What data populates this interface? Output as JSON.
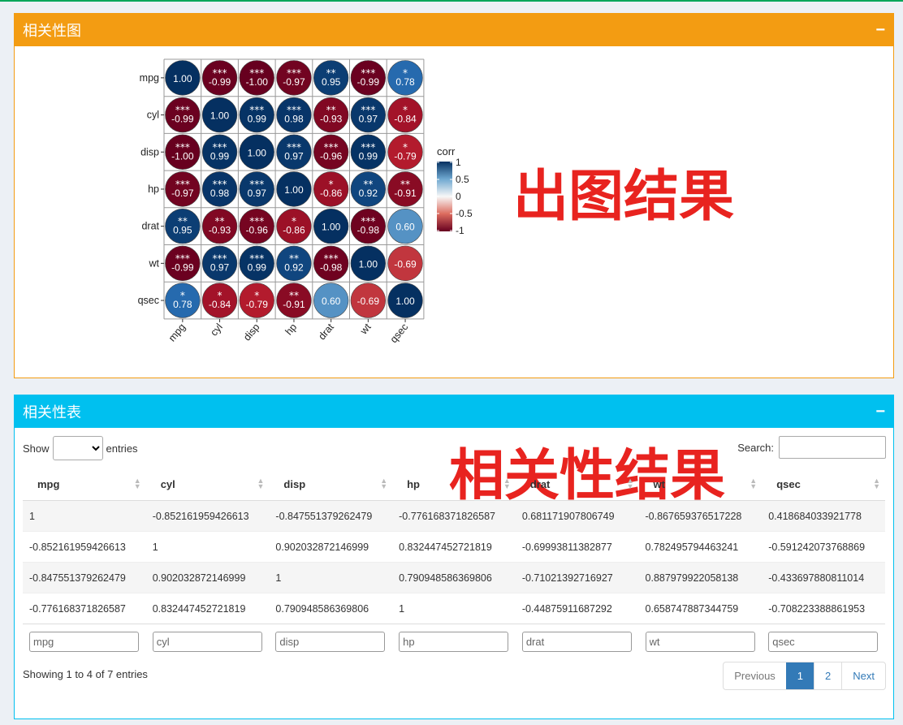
{
  "box1": {
    "title": "相关性图",
    "collapse": "−"
  },
  "box2": {
    "title": "相关性表",
    "collapse": "−"
  },
  "overlay1": "出图结果",
  "overlay2": "相关性结果",
  "chart_data": {
    "type": "heatmap",
    "variables": [
      "mpg",
      "cyl",
      "disp",
      "hp",
      "drat",
      "wt",
      "qsec"
    ],
    "values": [
      [
        1.0,
        -0.99,
        -1.0,
        -0.97,
        0.95,
        -0.99,
        0.78
      ],
      [
        -0.99,
        1.0,
        0.99,
        0.98,
        -0.93,
        0.97,
        -0.84
      ],
      [
        -1.0,
        0.99,
        1.0,
        0.97,
        -0.96,
        0.99,
        -0.79
      ],
      [
        -0.97,
        0.98,
        0.97,
        1.0,
        -0.86,
        0.92,
        -0.91
      ],
      [
        0.95,
        -0.93,
        -0.96,
        -0.86,
        1.0,
        -0.98,
        0.6
      ],
      [
        -0.99,
        0.97,
        0.99,
        0.92,
        -0.98,
        1.0,
        -0.69
      ],
      [
        0.78,
        -0.84,
        -0.79,
        -0.91,
        0.6,
        -0.69,
        1.0
      ]
    ],
    "labels": [
      [
        "1.00",
        "-0.99",
        "-1.00",
        "-0.97",
        "0.95",
        "-0.99",
        "0.78"
      ],
      [
        "-0.99",
        "1.00",
        "0.99",
        "0.98",
        "-0.93",
        "0.97",
        "-0.84"
      ],
      [
        "-1.00",
        "0.99",
        "1.00",
        "0.97",
        "-0.96",
        "0.99",
        "-0.79"
      ],
      [
        "-0.97",
        "0.98",
        "0.97",
        "1.00",
        "-0.86",
        "0.92",
        "-0.91"
      ],
      [
        "0.95",
        "-0.93",
        "-0.96",
        "-0.86",
        "1.00",
        "-0.98",
        "0.60"
      ],
      [
        "-0.99",
        "0.97",
        "0.99",
        "0.92",
        "-0.98",
        "1.00",
        "-0.69"
      ],
      [
        "0.78",
        "-0.84",
        "-0.79",
        "-0.91",
        "0.60",
        "-0.69",
        "1.00"
      ]
    ],
    "stars": [
      [
        "",
        "***",
        "***",
        "***",
        "**",
        "***",
        "*"
      ],
      [
        "***",
        "",
        "***",
        "***",
        "**",
        "***",
        "*"
      ],
      [
        "***",
        "***",
        "",
        "***",
        "***",
        "***",
        "*"
      ],
      [
        "***",
        "***",
        "***",
        "",
        "*",
        "**",
        "**"
      ],
      [
        "**",
        "**",
        "***",
        "*",
        "",
        "***",
        ""
      ],
      [
        "***",
        "***",
        "***",
        "**",
        "***",
        "",
        ""
      ],
      [
        "*",
        "*",
        "*",
        "**",
        "",
        "",
        ""
      ]
    ],
    "legend": {
      "title": "corr",
      "ticks": [
        "1",
        "0.5",
        "0",
        "-0.5",
        "-1"
      ],
      "range": [
        -1,
        1
      ]
    },
    "colors": {
      "high": "#053061",
      "mid": "#f7f7f7",
      "low": "#67001f"
    }
  },
  "table": {
    "show_label": "Show",
    "entries_label": "entries",
    "search_label": "Search:",
    "columns": [
      "mpg",
      "cyl",
      "disp",
      "hp",
      "drat",
      "wt",
      "qsec"
    ],
    "rows": [
      [
        "1",
        "-0.852161959426613",
        "-0.847551379262479",
        "-0.776168371826587",
        "0.681171907806749",
        "-0.867659376517228",
        "0.418684033921778"
      ],
      [
        "-0.852161959426613",
        "1",
        "0.902032872146999",
        "0.832447452721819",
        "-0.69993811382877",
        "0.782495794463241",
        "-0.591242073768869"
      ],
      [
        "-0.847551379262479",
        "0.902032872146999",
        "1",
        "0.790948586369806",
        "-0.71021392716927",
        "0.887979922058138",
        "-0.433697880811014"
      ],
      [
        "-0.776168371826587",
        "0.832447452721819",
        "0.790948586369806",
        "1",
        "-0.44875911687292",
        "0.658747887344759",
        "-0.708223388861953"
      ]
    ],
    "filters": [
      "mpg",
      "cyl",
      "disp",
      "hp",
      "drat",
      "wt",
      "qsec"
    ],
    "info": "Showing 1 to 4 of 7 entries",
    "pager": {
      "previous": "Previous",
      "pages": [
        "1",
        "2"
      ],
      "next": "Next",
      "active": "1"
    }
  }
}
